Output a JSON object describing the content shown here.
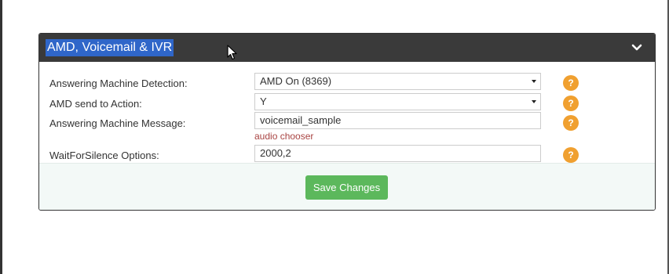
{
  "panel": {
    "title": "AMD, Voicemail & IVR",
    "collapse_icon": "chevron-down-icon"
  },
  "form": {
    "answering_machine_detection": {
      "label": "Answering Machine Detection:",
      "value": "AMD On (8369)"
    },
    "amd_send_to_action": {
      "label": "AMD send to Action:",
      "value": "Y"
    },
    "answering_machine_message": {
      "label": "Answering Machine Message:",
      "value": "voicemail_sample",
      "link": "audio chooser"
    },
    "wait_for_silence": {
      "label": "WaitForSilence Options:",
      "value": "2000,2"
    },
    "help_glyph": "?"
  },
  "footer": {
    "save_label": "Save Changes"
  },
  "colors": {
    "header_bg": "#3a3a3a",
    "selection": "#2f66c9",
    "help_badge": "#f0a030",
    "link": "#a94442",
    "save_button": "#5cb85c",
    "footer_bg": "#f3f9f7"
  }
}
